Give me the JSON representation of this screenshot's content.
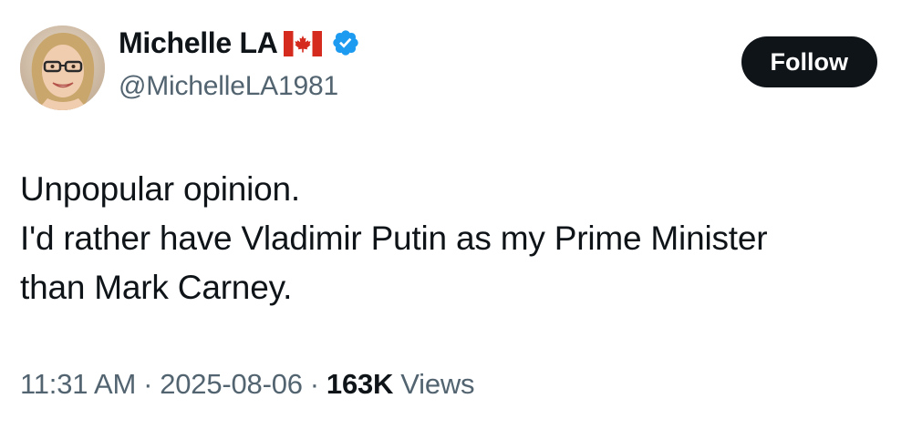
{
  "author": {
    "display_name": "Michelle LA",
    "flag_icon": "canada-flag-icon",
    "verified_icon": "verified-badge-icon",
    "handle": "@MichelleLA1981"
  },
  "actions": {
    "follow_label": "Follow"
  },
  "post": {
    "lines": [
      "Unpopular opinion.",
      "I'd rather have Vladimir Putin as my Prime Minister",
      "than Mark Carney."
    ]
  },
  "meta": {
    "time": "11:31 AM",
    "date": "2025-08-06",
    "separator": "·",
    "views_count": "163K",
    "views_label": "Views"
  },
  "colors": {
    "text_primary": "#0f1419",
    "text_secondary": "#536471",
    "verified_blue": "#1d9bf0",
    "flag_red": "#d52b1e",
    "button_bg": "#0f1419"
  }
}
